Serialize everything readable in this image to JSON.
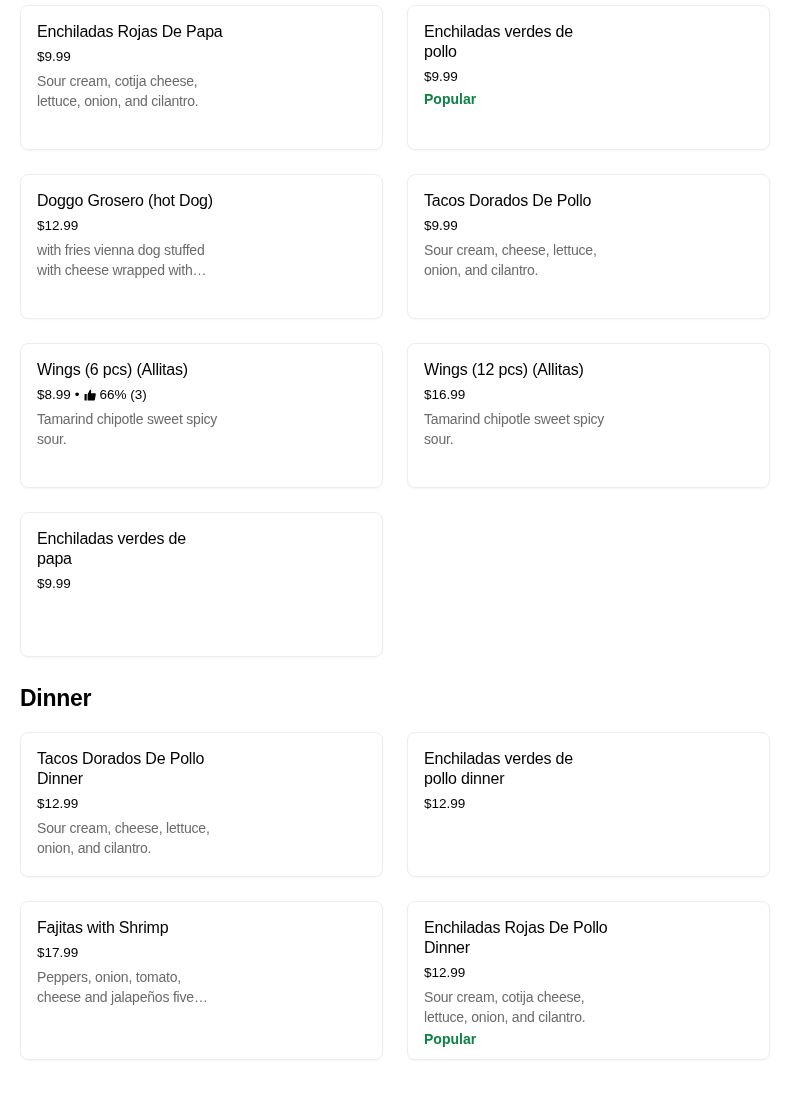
{
  "sections": [
    {
      "items": [
        {
          "name": "Enchiladas Rojas De Papa",
          "price": "$9.99",
          "description": "Sour cream, cotija cheese, lettuce, onion, and cilantro."
        },
        {
          "name": "Enchiladas verdes de pollo",
          "price": "$9.99",
          "badge": "Popular"
        },
        {
          "name": "Doggo Grosero (hot Dog)",
          "price": "$12.99",
          "description": "with fries vienna dog stuffed with cheese wrapped with…"
        },
        {
          "name": "Tacos Dorados De Pollo",
          "price": "$9.99",
          "description": "Sour cream, cheese, lettuce, onion, and cilantro."
        },
        {
          "name": "Wings (6 pcs) (Allitas)",
          "price": "$8.99",
          "separator": "•",
          "rating": "66% (3)",
          "description": "Tamarind chipotle sweet spicy sour."
        },
        {
          "name": "Wings (12 pcs) (Allitas)",
          "price": "$16.99",
          "description": "Tamarind chipotle sweet spicy sour."
        },
        {
          "name": "Enchiladas verdes de papa",
          "price": "$9.99"
        }
      ]
    },
    {
      "title": "Dinner",
      "items": [
        {
          "name": "Tacos Dorados De Pollo Dinner",
          "price": "$12.99",
          "description": "Sour cream, cheese, lettuce, onion, and cilantro."
        },
        {
          "name": "Enchiladas verdes de pollo dinner",
          "price": "$12.99"
        },
        {
          "name": "Fajitas with Shrimp",
          "price": "$17.99",
          "description": "Peppers, onion, tomato, cheese and jalapeños five…"
        },
        {
          "name": "Enchiladas Rojas De Pollo Dinner",
          "price": "$12.99",
          "description": "Sour cream, cotija cheese, lettuce, onion, and cilantro.",
          "badge": "Popular"
        }
      ]
    }
  ]
}
